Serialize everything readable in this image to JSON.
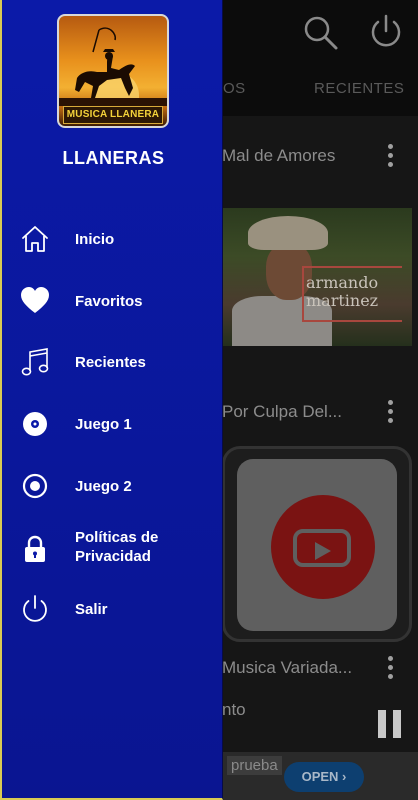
{
  "background_app": {
    "tabs": [
      "OS",
      "RECIENTES"
    ],
    "rows": [
      {
        "title": "Mal de Amores"
      },
      {
        "title": "Por Culpa Del..."
      },
      {
        "title": "Musica Variada..."
      }
    ],
    "thumbnail_text": "armando martinez",
    "now_playing": "nto",
    "ad": {
      "text": "prueba",
      "button": "OPEN"
    }
  },
  "drawer": {
    "logo_text": "MUSICA LLANERA",
    "title": "LLANERAS",
    "items": [
      {
        "label": "Inicio",
        "icon": "home-icon"
      },
      {
        "label": "Favoritos",
        "icon": "heart-icon"
      },
      {
        "label": "Recientes",
        "icon": "music-note-icon"
      },
      {
        "label": "Juego 1",
        "icon": "disc-icon"
      },
      {
        "label": "Juego 2",
        "icon": "radio-button-icon"
      },
      {
        "label": "Políticas de Privacidad",
        "icon": "lock-icon"
      },
      {
        "label": "Salir",
        "icon": "power-icon"
      }
    ]
  },
  "colors": {
    "drawer_background": "#0b1aa8",
    "drawer_border": "#d9cb53",
    "text": "#ffffff"
  }
}
